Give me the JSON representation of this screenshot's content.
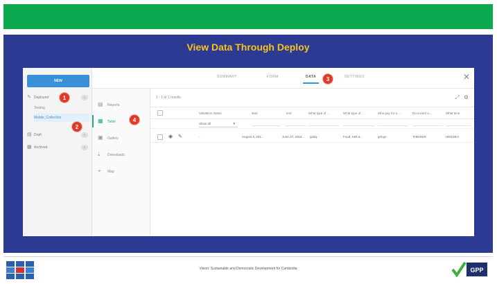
{
  "slide": {
    "title": "View Data Through Deploy",
    "footer_text": "Vision: Sustainable and Democratic Development for Cambodia",
    "footer_badge": "GPP",
    "colors": {
      "top_bar": "#0aa84f",
      "panel": "#2c3a94",
      "title": "#f5c518",
      "badge": "#e03a2a"
    }
  },
  "app": {
    "new_button": "NEW",
    "left_nav": [
      {
        "label": "Deployed",
        "count": "1",
        "icon": "pencil-icon"
      },
      {
        "label": "Draft",
        "count": "0",
        "icon": "file-icon"
      },
      {
        "label": "Archived",
        "count": "0",
        "icon": "archive-icon"
      }
    ],
    "deployed_children": [
      "Testing",
      "Mobile_Collection"
    ],
    "tabs": [
      "SUMMARY",
      "FORM",
      "DATA",
      "SETTINGS"
    ],
    "active_tab": "DATA",
    "second_nav": [
      {
        "label": "Reports",
        "icon": "reports-icon"
      },
      {
        "label": "Table",
        "icon": "table-icon"
      },
      {
        "label": "Gallery",
        "icon": "gallery-icon"
      },
      {
        "label": "Downloads",
        "icon": "download-icon"
      },
      {
        "label": "Map",
        "icon": "map-icon"
      }
    ],
    "results_text": "1 - 1 of 1 results",
    "filter": {
      "show_all": "Show all"
    },
    "columns": [
      "Validation status",
      "start",
      "end",
      "What type of ...",
      "What type of ...",
      "Who pay for a ...",
      "Do invited a...",
      "What time"
    ],
    "row": [
      "-",
      "August 3, 201...",
      "June 27, 2016...",
      "giday",
      "Food, Hell a...",
      "gringo",
      "THEHIER",
      "HERSEH"
    ],
    "badges": [
      "1",
      "2",
      "3",
      "4"
    ]
  }
}
